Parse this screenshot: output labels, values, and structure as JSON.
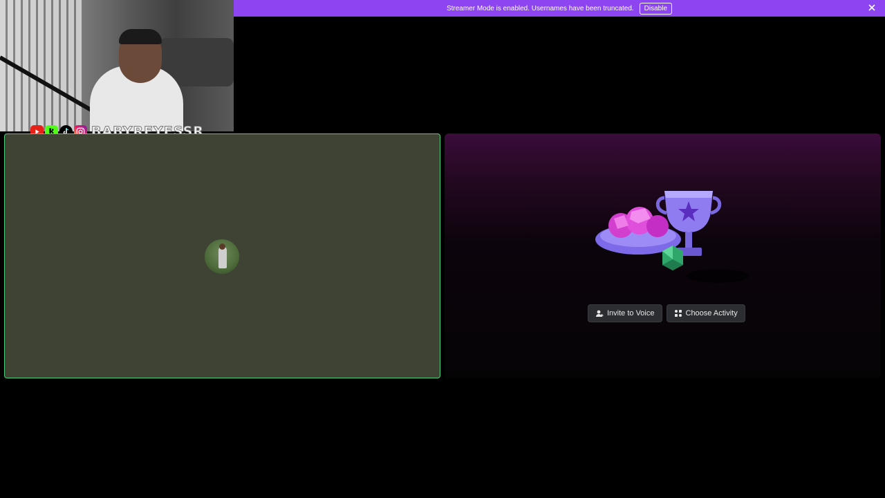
{
  "banner": {
    "message": "Streamer Mode is enabled. Usernames have been truncated.",
    "disable_label": "Disable",
    "color": "#8c45f0"
  },
  "overlay": {
    "handle": "BABYREYESSR",
    "social_icons": [
      "youtube-icon",
      "kick-icon",
      "tiktok-icon",
      "instagram-icon"
    ]
  },
  "voice_tile": {
    "border_color": "#4dd17a",
    "background": "#3f4333"
  },
  "activity_tile": {
    "invite_label": "Invite to Voice",
    "choose_label": "Choose Activity"
  }
}
